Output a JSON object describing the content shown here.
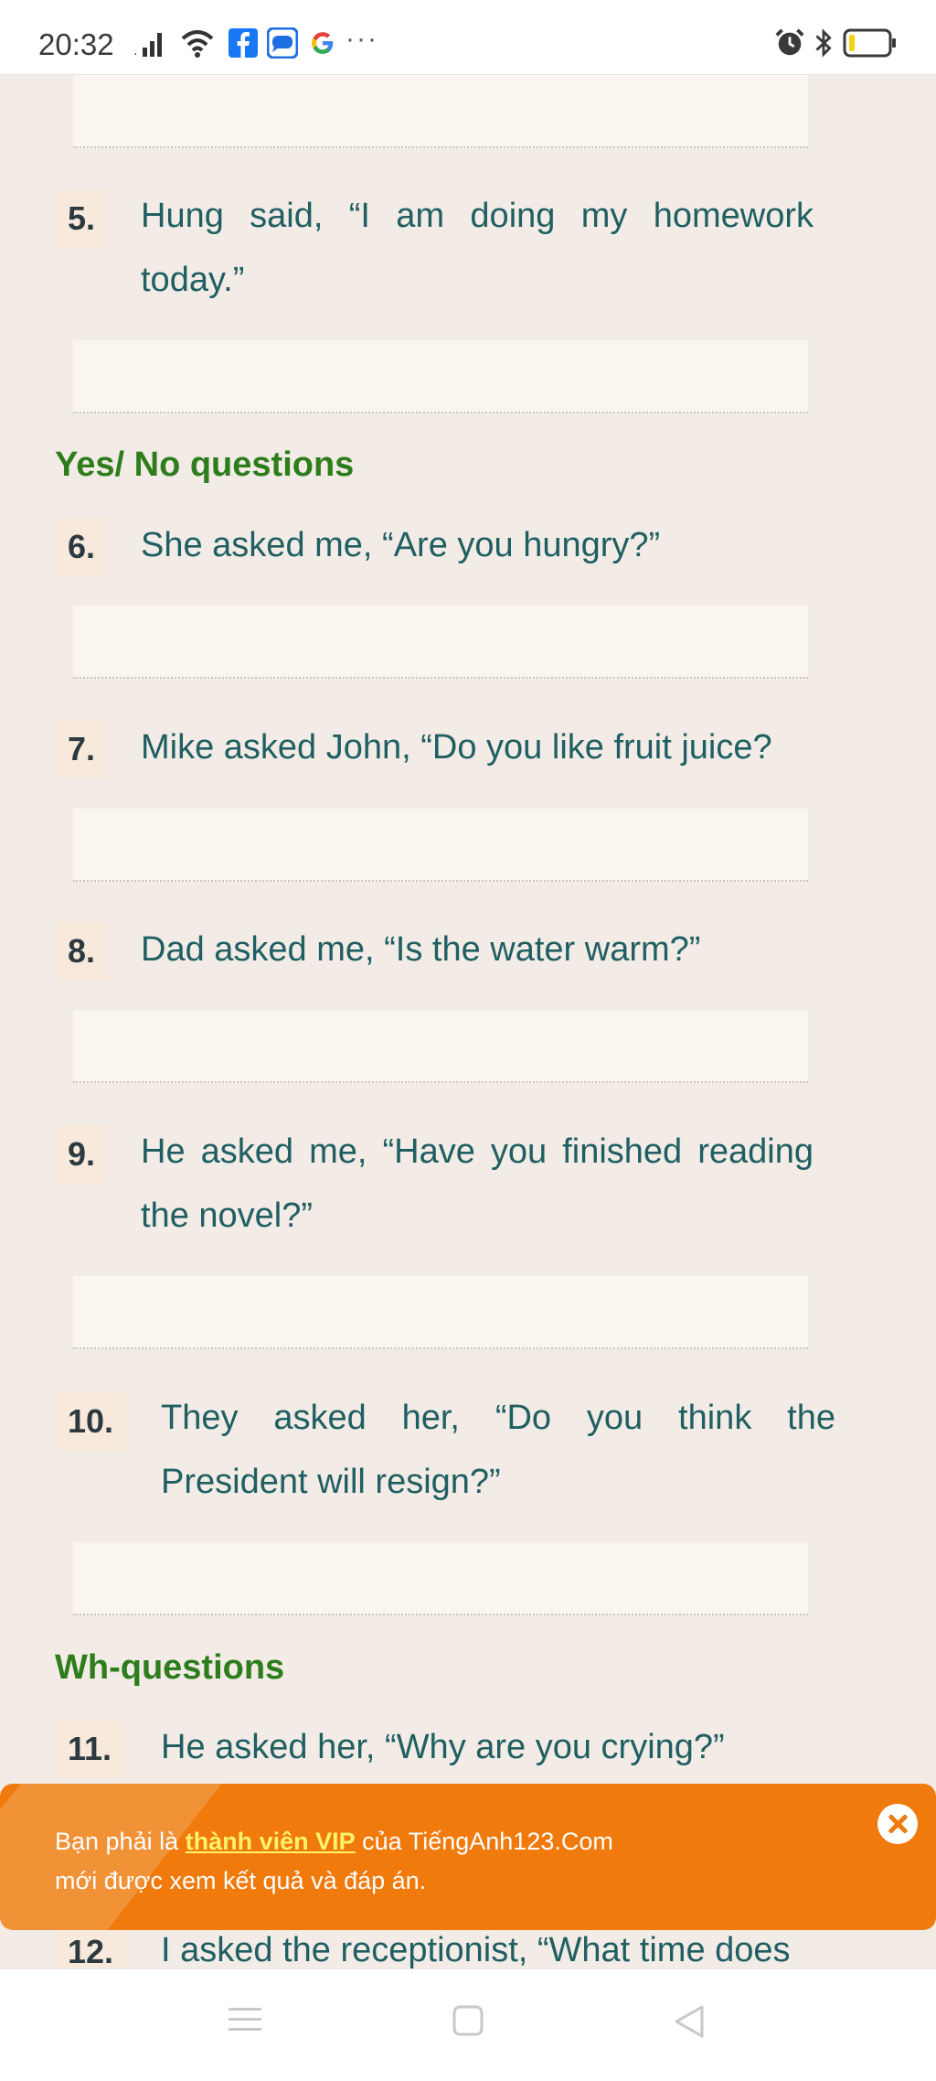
{
  "status_bar": {
    "time": "20:32",
    "icons": [
      "signal-icon",
      "wifi-icon",
      "facebook-icon",
      "zalo-icon",
      "google-icon",
      "more-notifications-icon",
      "alarm-icon",
      "bluetooth-icon",
      "battery-icon"
    ],
    "more": "···"
  },
  "exercise": {
    "questions_before": [
      {
        "number": "5.",
        "text": "Hung said, “I am doing my homework today.”"
      }
    ],
    "sections": [
      {
        "title": "Yes/ No questions",
        "questions": [
          {
            "number": "6.",
            "text": "She asked me, “Are you hungry?”"
          },
          {
            "number": "7.",
            "text": "Mike asked John, “Do you like fruit juice?"
          },
          {
            "number": "8.",
            "text": "Dad asked me, “Is the water warm?”"
          },
          {
            "number": "9.",
            "text": "He asked me, “Have you finished reading the novel?”"
          },
          {
            "number": "10.",
            "text": "They asked her, “Do you think the President will resign?”"
          }
        ]
      },
      {
        "title": "Wh-questions",
        "questions": [
          {
            "number": "11.",
            "text": "He asked her, “Why are you crying?”"
          },
          {
            "number": "12.",
            "text": "I asked the receptionist, “What time does"
          }
        ]
      }
    ]
  },
  "vip_banner": {
    "line1_prefix": "Bạn phải là ",
    "link_text": "thành viên VIP",
    "line1_suffix": " của TiếngAnh123.Com",
    "line2": "mới được xem kết quả và đáp án."
  },
  "nav_bar": {
    "buttons": [
      "menu-icon",
      "home-icon",
      "back-icon"
    ]
  },
  "colors": {
    "page_background": "#f2ebe6",
    "question_text": "#1f5f62",
    "section_title": "#2e7d1c",
    "number_badge": "#f7e9dc",
    "answer_box": "#f8f6ee",
    "banner": "#f07a0c",
    "banner_link": "#fff36b"
  }
}
